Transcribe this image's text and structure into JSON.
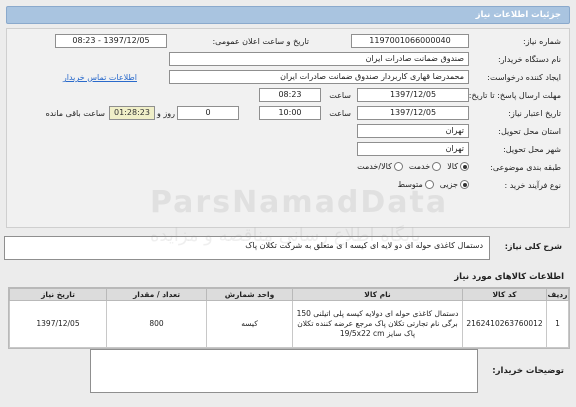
{
  "header": {
    "title": "جزئیات اطلاعات نیاز"
  },
  "form": {
    "need_number_label": "شماره نیاز:",
    "need_number": "1197001066000040",
    "announce_label": "تاریخ و ساعت اعلان عمومی:",
    "announce_value": "1397/12/05 - 08:23",
    "buyer_org_label": "نام دستگاه خریدار:",
    "buyer_org": "صندوق ضمانت صادرات ایران",
    "creator_label": "ایجاد کننده درخواست:",
    "creator": "محمدرضا قهاری کاربردار صندوق ضمانت صادرات ایران",
    "contact_link": "اطلاعات تماس خریدار",
    "reply_deadline_label": "مهلت ارسال پاسخ: تا تاریخ:",
    "reply_date": "1397/12/05",
    "time_label": "ساعت",
    "reply_time": "08:23",
    "validity_label": "تاریخ اعتبار نیاز:",
    "validity_date": "1397/12/05",
    "validity_time_label": "ساعت",
    "validity_time": "10:00",
    "days": "0",
    "days_label": "روز و",
    "remaining": "01:28:23",
    "remaining_label": "ساعت باقی مانده",
    "province_label": "استان محل تحویل:",
    "province": "تهران",
    "city_label": "شهر محل تحویل:",
    "city": "تهران",
    "category_label": "طبقه بندی موضوعی:",
    "category_options": [
      "کالا",
      "خدمت",
      "کالا/خدمت"
    ],
    "process_label": "نوع فرآیند خرید :",
    "process_options": [
      "جزیی",
      "متوسط"
    ]
  },
  "description": {
    "label": "شرح کلی نیاز:",
    "text": "دستمال کاغذی حوله ای دو لایه ای کیسه ا ی متعلق به شرکت تکلان پاک"
  },
  "goods": {
    "title": "اطلاعات کالاهای مورد نیاز",
    "columns": [
      "ردیف",
      "کد کالا",
      "نام کالا",
      "واحد شمارش",
      "تعداد / مقدار",
      "تاریخ نیاز"
    ],
    "rows": [
      {
        "row": "1",
        "code": "2162410263760012",
        "name": "دستمال کاغذی حوله ای دولایه کیسه پلی اتیلنی 150 برگی نام تجارتی تکلان پاک مرجع عرضه کننده تکلان پاک سایز 19/5x22 cm",
        "unit": "کیسه",
        "qty": "800",
        "date": "1397/12/05"
      }
    ]
  },
  "buyer_notes": {
    "label": "توضیحات خریدار:"
  },
  "watermark": {
    "line1": "ParsNamadData",
    "line2": "پایگاه اطلاع رسانی مناقصه و مزایده"
  }
}
